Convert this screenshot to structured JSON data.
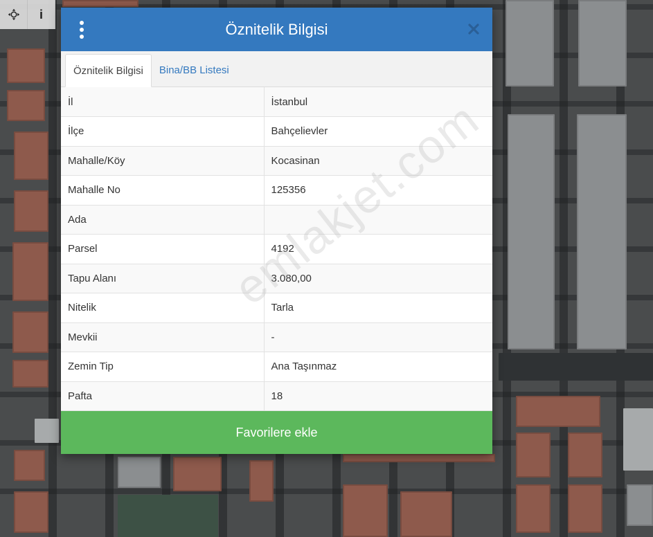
{
  "map_toolbar": {
    "pan_icon": "move-icon",
    "info_label": "i"
  },
  "modal": {
    "title": "Öznitelik Bilgisi",
    "menu_icon": "kebab-menu-icon",
    "close_icon": "close-icon",
    "tabs": [
      {
        "label": "Öznitelik Bilgisi",
        "active": true
      },
      {
        "label": "Bina/BB Listesi",
        "active": false
      }
    ],
    "rows": [
      {
        "key": "İl",
        "value": "İstanbul"
      },
      {
        "key": "İlçe",
        "value": "Bahçelievler"
      },
      {
        "key": "Mahalle/Köy",
        "value": "Kocasinan"
      },
      {
        "key": "Mahalle No",
        "value": "125356"
      },
      {
        "key": "Ada",
        "value": ""
      },
      {
        "key": "Parsel",
        "value": "4192"
      },
      {
        "key": "Tapu Alanı",
        "value": "3.080,00"
      },
      {
        "key": "Nitelik",
        "value": "Tarla"
      },
      {
        "key": "Mevkii",
        "value": "-"
      },
      {
        "key": "Zemin Tip",
        "value": "Ana Taşınmaz"
      },
      {
        "key": "Pafta",
        "value": "18"
      }
    ],
    "favorite_button": "Favorilere ekle"
  },
  "watermark": "emlakjet.com",
  "colors": {
    "header": "#3479bf",
    "favorite_button": "#5cb85c",
    "tab_link": "#3479bf"
  }
}
